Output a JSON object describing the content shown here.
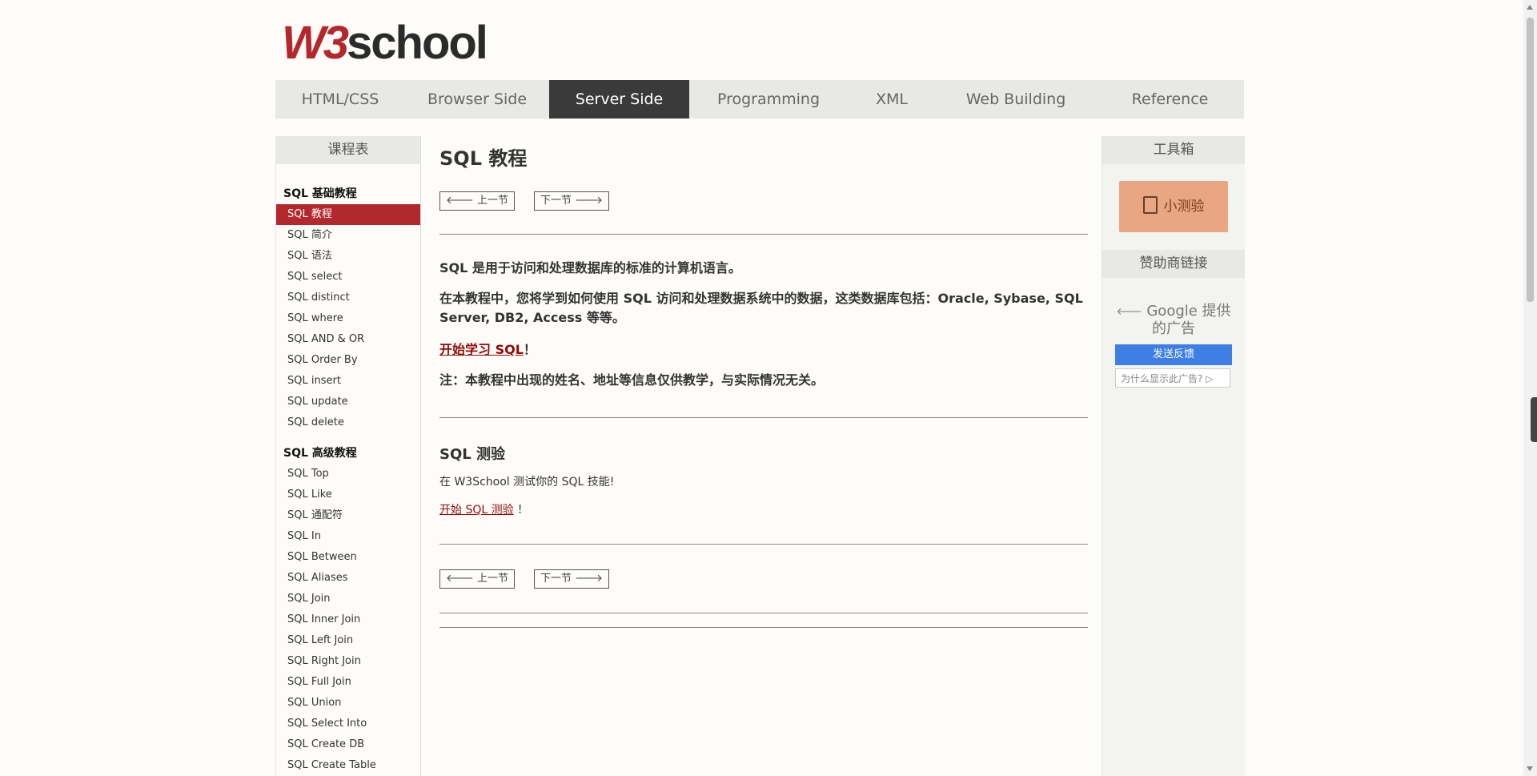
{
  "logo": {
    "w3": "W3",
    "school": "school"
  },
  "nav": {
    "tabs": [
      {
        "label": "HTML/CSS"
      },
      {
        "label": "Browser Side"
      },
      {
        "label": "Server Side"
      },
      {
        "label": "Programming"
      },
      {
        "label": "XML"
      },
      {
        "label": "Web Building"
      },
      {
        "label": "Reference"
      }
    ],
    "active": "Server Side"
  },
  "sidebar": {
    "title": "课程表",
    "groups": [
      {
        "title": "SQL 基础教程",
        "items": [
          "SQL 教程",
          "SQL 简介",
          "SQL 语法",
          "SQL select",
          "SQL distinct",
          "SQL where",
          "SQL AND & OR",
          "SQL Order By",
          "SQL insert",
          "SQL update",
          "SQL delete"
        ]
      },
      {
        "title": "SQL 高级教程",
        "items": [
          "SQL Top",
          "SQL Like",
          "SQL 通配符",
          "SQL In",
          "SQL Between",
          "SQL Aliases",
          "SQL Join",
          "SQL Inner Join",
          "SQL Left Join",
          "SQL Right Join",
          "SQL Full Join",
          "SQL Union",
          "SQL Select Into",
          "SQL Create DB",
          "SQL Create Table"
        ]
      }
    ],
    "active_item": "SQL 教程"
  },
  "main": {
    "title": "SQL 教程",
    "prev_label": "上一节",
    "next_label": "下一节",
    "intro": "SQL 是用于访问和处理数据库的标准的计算机语言。",
    "para2": "在本教程中，您将学到如何使用 SQL 访问和处理数据系统中的数据，这类数据库包括：Oracle, Sybase, SQL Server, DB2, Access 等等。",
    "start_link": "开始学习 SQL",
    "exclaim": "！",
    "note": "注：本教程中出现的姓名、地址等信息仅供教学，与实际情况无关。",
    "quiz_title": "SQL 测验",
    "quiz_text": "在 W3School 测试你的 SQL 技能!",
    "quiz_link": "开始 SQL 测验"
  },
  "toolbox": {
    "title": "工具箱",
    "quiz_button": "小测验",
    "sponsor_title": "赞助商链接",
    "ad_google": "Google 提供的广告",
    "ad_feedback": "发送反馈",
    "ad_why": "为什么显示此广告?"
  }
}
